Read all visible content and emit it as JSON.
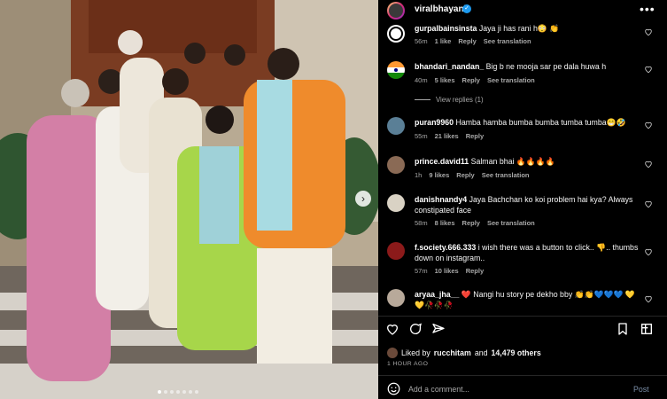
{
  "post": {
    "username": "viralbhayani",
    "image_alt": "Family photo on stairs",
    "liked_by_user": "rucchitam",
    "likes_count": "14,479 others",
    "time_ago": "1 HOUR AGO",
    "liked_prefix": "Liked by",
    "and_text": "and"
  },
  "comments": [
    {
      "user": "gurpalbainsinsta",
      "text": "Jaya ji has rani h😳 👏",
      "time": "56m",
      "likes": "1 like",
      "reply": "Reply",
      "translate": "See translation"
    },
    {
      "user": "bhandari_nandan_",
      "text": "Big b ne mooja sar pe dala huwa h",
      "time": "40m",
      "likes": "5 likes",
      "reply": "Reply",
      "translate": "See translation"
    },
    {
      "user": "puran9960",
      "text": "Hamba hamba bumba bumba tumba tumba😁🤣",
      "time": "55m",
      "likes": "21 likes",
      "reply": "Reply",
      "translate": ""
    },
    {
      "user": "prince.david11",
      "text": "Salman bhai 🔥🔥🔥🔥",
      "time": "1h",
      "likes": "9 likes",
      "reply": "Reply",
      "translate": "See translation"
    },
    {
      "user": "danishnandy4",
      "text": "Jaya Bachchan ko koi problem hai kya? Always constipated face",
      "time": "58m",
      "likes": "8 likes",
      "reply": "Reply",
      "translate": "See translation"
    },
    {
      "user": "f.society.666.333",
      "text": "i wish there was a button to click.. 👎.. thumbs down on instagram..",
      "time": "57m",
      "likes": "10 likes",
      "reply": "Reply",
      "translate": ""
    },
    {
      "user": "aryaa_jha__",
      "text": "❤️ Nangi hu story pe dekho bby 👏👏💙💙💙 💛💛🥀🥀🥀",
      "time": "",
      "likes": "",
      "reply": "",
      "translate": ""
    }
  ],
  "view_replies": "View replies (1)",
  "add_comment": {
    "placeholder": "Add a comment...",
    "post_label": "Post"
  },
  "colors": {
    "verified": "#1d9bf0",
    "post_link": "#7a8ea7",
    "meta": "#a8a8a8"
  },
  "icons": [
    "more-options-icon",
    "heart-icon",
    "comment-icon",
    "share-icon",
    "bookmark-icon",
    "emoji-icon",
    "next-arrow-icon"
  ]
}
